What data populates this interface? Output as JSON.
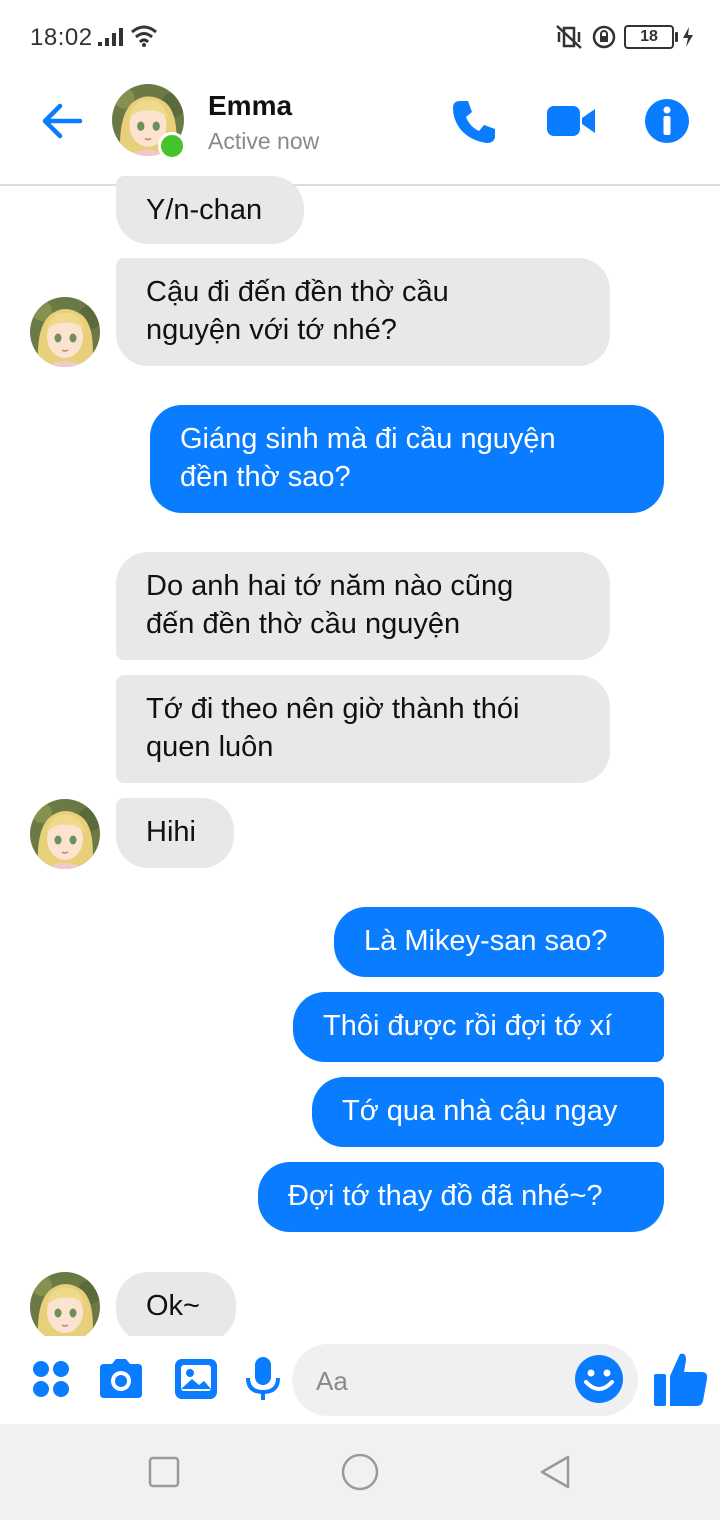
{
  "status_bar": {
    "time": "18:02",
    "battery": "18"
  },
  "header": {
    "name": "Emma",
    "status": "Active now"
  },
  "messages": [
    {
      "dir": "in",
      "text": "Y/n-chan"
    },
    {
      "dir": "in",
      "line1": "Cậu đi đến đền thờ cầu",
      "line2": "nguyện với tớ nhé?"
    },
    {
      "dir": "out",
      "line1": "Giáng sinh mà đi cầu nguyện",
      "line2": "đền thờ sao?"
    },
    {
      "dir": "in",
      "line1": "Do anh hai tớ năm nào cũng",
      "line2": "đến đền thờ cầu nguyện"
    },
    {
      "dir": "in",
      "line1": "Tớ đi theo nên giờ thành thói",
      "line2": "quen luôn"
    },
    {
      "dir": "in",
      "text": "Hihi"
    },
    {
      "dir": "out",
      "text": "Là Mikey-san sao?"
    },
    {
      "dir": "out",
      "text": "Thôi được rồi đợi tớ xí"
    },
    {
      "dir": "out",
      "text": "Tớ qua nhà cậu ngay"
    },
    {
      "dir": "out",
      "text": "Đợi tớ thay đồ đã nhé~?"
    },
    {
      "dir": "in",
      "text": "Ok~"
    }
  ],
  "composer": {
    "placeholder": "Aa"
  },
  "colors": {
    "accent": "#0a7cff",
    "incoming_bubble": "#e8e8e8",
    "online": "#44c42a"
  },
  "icons": [
    "back-arrow-icon",
    "phone-icon",
    "video-camera-icon",
    "info-icon",
    "apps-icon",
    "camera-icon",
    "gallery-icon",
    "microphone-icon",
    "emoji-icon",
    "thumbs-up-icon",
    "recent-apps-icon",
    "home-icon",
    "back-nav-icon"
  ]
}
